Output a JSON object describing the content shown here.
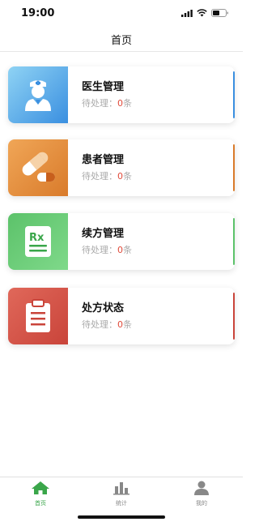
{
  "status": {
    "time": "19:00"
  },
  "nav": {
    "title": "首页"
  },
  "cards": [
    {
      "title": "医生管理",
      "pending_label": "待处理：",
      "count": "0",
      "unit": "条",
      "icon": "doctor-icon",
      "color_from": "#8fd3f4",
      "color_to": "#3a8fe0"
    },
    {
      "title": "患者管理",
      "pending_label": "待处理：",
      "count": "0",
      "unit": "条",
      "icon": "pills-icon",
      "color_from": "#f0a657",
      "color_to": "#d97b2b"
    },
    {
      "title": "续方管理",
      "pending_label": "待处理：",
      "count": "0",
      "unit": "条",
      "icon": "prescription-icon",
      "color_from": "#5cc26a",
      "color_to": "#7fd98a"
    },
    {
      "title": "处方状态",
      "pending_label": "待处理：",
      "count": "0",
      "unit": "条",
      "icon": "clipboard-icon",
      "color_from": "#e0685a",
      "color_to": "#c9443a"
    }
  ],
  "tabs": [
    {
      "label": "首页",
      "icon": "home-icon",
      "active": true
    },
    {
      "label": "统计",
      "icon": "chart-icon",
      "active": false
    },
    {
      "label": "我的",
      "icon": "user-icon",
      "active": false
    }
  ],
  "colors": {
    "active_tab": "#3aa64a",
    "inactive_tab": "#888888",
    "count": "#e04a3a"
  }
}
